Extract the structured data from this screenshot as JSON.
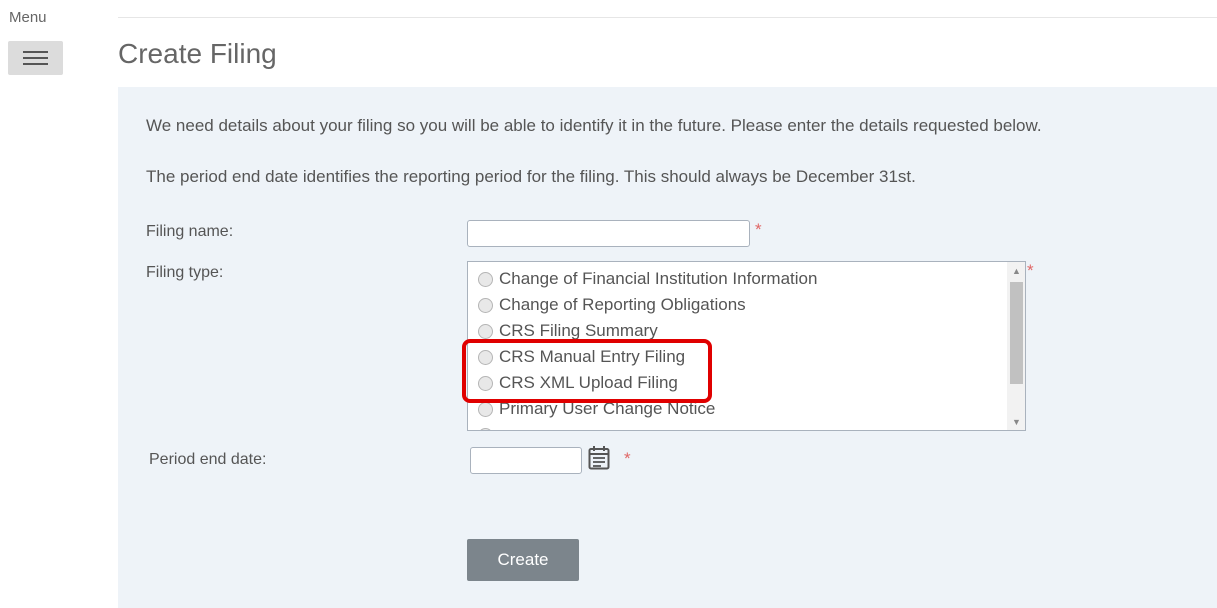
{
  "menu": {
    "label": "Menu",
    "icon": "hamburger-icon"
  },
  "page": {
    "title": "Create Filing"
  },
  "intro": {
    "line1": "We need details about your filing so you will be able to identify it in the future. Please enter the details requested below.",
    "line2": "The period end date identifies the reporting period for the filing. This should always be December 31st."
  },
  "form": {
    "filing_name": {
      "label": "Filing name:",
      "value": "",
      "required_mark": "*"
    },
    "filing_type": {
      "label": "Filing type:",
      "required_mark": "*",
      "options": [
        "Change of Financial Institution Information",
        "Change of Reporting Obligations",
        "CRS Filing Summary",
        "CRS Manual Entry Filing",
        "CRS XML Upload Filing",
        "Primary User Change Notice"
      ],
      "highlighted_options": [
        "CRS Manual Entry Filing",
        "CRS XML Upload Filing"
      ]
    },
    "period_end_date": {
      "label": "Period end date:",
      "value": "",
      "required_mark": "*",
      "icon": "calendar-icon"
    }
  },
  "actions": {
    "create_label": "Create"
  },
  "colors": {
    "panel_bg": "#eef3f8",
    "required": "#e06666",
    "highlight": "#e00000",
    "button_bg": "#7c858c"
  }
}
